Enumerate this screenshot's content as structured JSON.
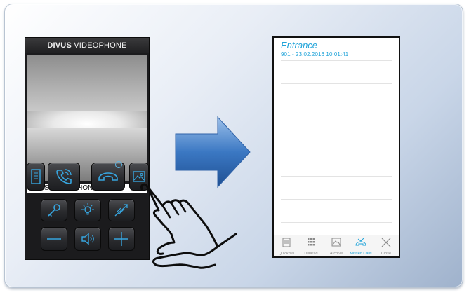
{
  "left_phone": {
    "title_bold": "DIVUS",
    "title_rest": " VIDEOPHONE",
    "caller_label": "DIVUS VIDEOPHONE"
  },
  "right_phone": {
    "title": "Entrance",
    "entry": "901 - 23.02.2016  10:01:41",
    "tabs": [
      {
        "label": "Quickdial",
        "icon": "quickdial-icon"
      },
      {
        "label": "DialPad",
        "icon": "dialpad-icon"
      },
      {
        "label": "Archive",
        "icon": "archive-icon"
      },
      {
        "label": "Missed Calls",
        "icon": "missed-calls-icon",
        "active": true
      },
      {
        "label": "Close",
        "icon": "close-icon"
      }
    ]
  },
  "colors": {
    "accent": "#1fa3d9",
    "arrow": "#3b78c3",
    "phone_bg": "#1b1b1d"
  }
}
